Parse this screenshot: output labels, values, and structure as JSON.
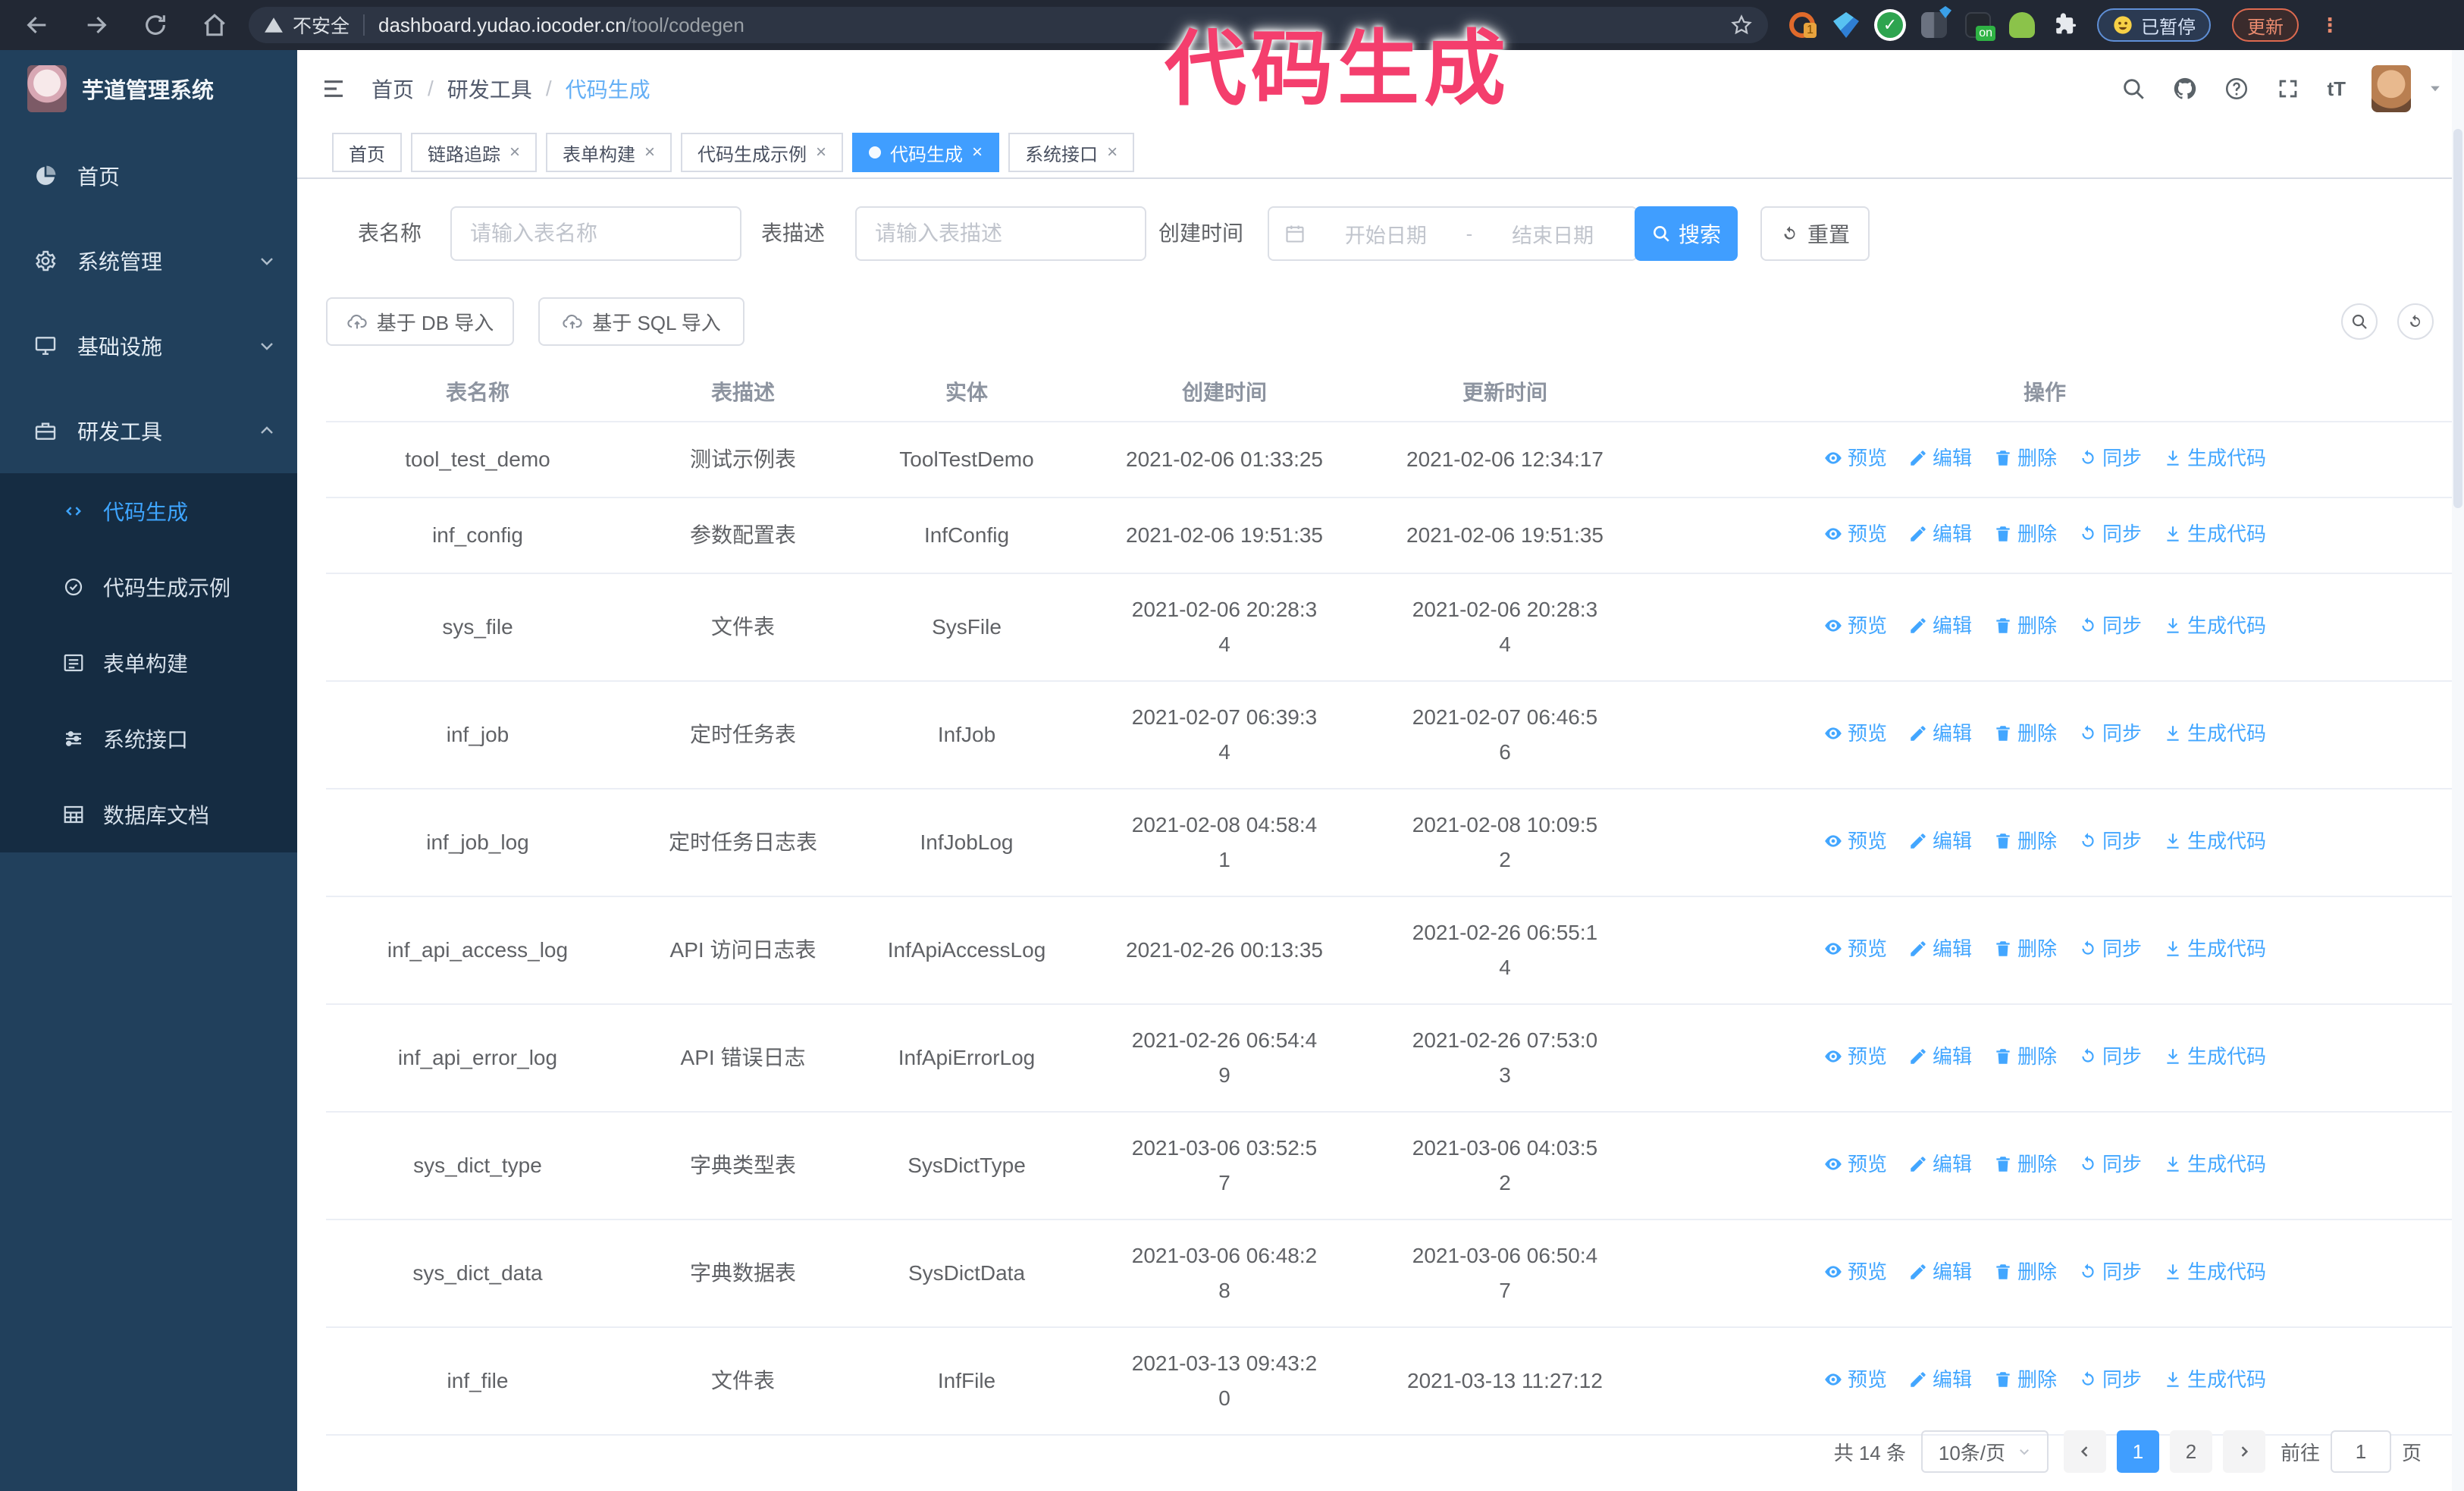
{
  "browser": {
    "security_label": "不安全",
    "url_host": "dashboard.yudao.iocoder.cn",
    "url_path": "/tool/codegen",
    "extension_badge": "1",
    "extension_on_badge": "on",
    "paused_badge": "已暂停",
    "update_button": "更新"
  },
  "annotation": {
    "text": "代码生成"
  },
  "sidebar": {
    "logo_title": "芋道管理系统",
    "items": [
      {
        "label": "首页"
      },
      {
        "label": "系统管理"
      },
      {
        "label": "基础设施"
      },
      {
        "label": "研发工具"
      }
    ],
    "submenu": [
      {
        "label": "代码生成"
      },
      {
        "label": "代码生成示例"
      },
      {
        "label": "表单构建"
      },
      {
        "label": "系统接口"
      },
      {
        "label": "数据库文档"
      }
    ]
  },
  "header": {
    "breadcrumb": [
      "首页",
      "研发工具",
      "代码生成"
    ],
    "text_size_icon": "tT"
  },
  "tabs": [
    {
      "label": "首页"
    },
    {
      "label": "链路追踪"
    },
    {
      "label": "表单构建"
    },
    {
      "label": "代码生成示例"
    },
    {
      "label": "代码生成"
    },
    {
      "label": "系统接口"
    }
  ],
  "filters": {
    "table_name_label": "表名称",
    "table_name_placeholder": "请输入表名称",
    "table_desc_label": "表描述",
    "table_desc_placeholder": "请输入表描述",
    "create_time_label": "创建时间",
    "start_placeholder": "开始日期",
    "range_separator": "-",
    "end_placeholder": "结束日期",
    "search_button": "搜索",
    "reset_button": "重置"
  },
  "toolbar": {
    "import_db": "基于 DB 导入",
    "import_sql": "基于 SQL 导入"
  },
  "table": {
    "columns": [
      "表名称",
      "表描述",
      "实体",
      "创建时间",
      "更新时间",
      "操作"
    ],
    "actions": [
      {
        "label": "预览",
        "icon": "eye-icon"
      },
      {
        "label": "编辑",
        "icon": "edit-icon"
      },
      {
        "label": "删除",
        "icon": "delete-icon"
      },
      {
        "label": "同步",
        "icon": "sync-icon"
      },
      {
        "label": "生成代码",
        "icon": "download-icon"
      }
    ],
    "rows": [
      {
        "name": "tool_test_demo",
        "desc": "测试示例表",
        "entity": "ToolTestDemo",
        "created": "2021-02-06 01:33:25",
        "updated": "2021-02-06 12:34:17"
      },
      {
        "name": "inf_config",
        "desc": "参数配置表",
        "entity": "InfConfig",
        "created": "2021-02-06 19:51:35",
        "updated": "2021-02-06 19:51:35"
      },
      {
        "name": "sys_file",
        "desc": "文件表",
        "entity": "SysFile",
        "created": "2021-02-06 20:28:3\n4",
        "updated": "2021-02-06 20:28:3\n4"
      },
      {
        "name": "inf_job",
        "desc": "定时任务表",
        "entity": "InfJob",
        "created": "2021-02-07 06:39:3\n4",
        "updated": "2021-02-07 06:46:5\n6"
      },
      {
        "name": "inf_job_log",
        "desc": "定时任务日志表",
        "entity": "InfJobLog",
        "created": "2021-02-08 04:58:4\n1",
        "updated": "2021-02-08 10:09:5\n2"
      },
      {
        "name": "inf_api_access_log",
        "desc": "API 访问日志表",
        "entity": "InfApiAccessLog",
        "created": "2021-02-26 00:13:35",
        "updated": "2021-02-26 06:55:1\n4"
      },
      {
        "name": "inf_api_error_log",
        "desc": "API 错误日志",
        "entity": "InfApiErrorLog",
        "created": "2021-02-26 06:54:4\n9",
        "updated": "2021-02-26 07:53:0\n3"
      },
      {
        "name": "sys_dict_type",
        "desc": "字典类型表",
        "entity": "SysDictType",
        "created": "2021-03-06 03:52:5\n7",
        "updated": "2021-03-06 04:03:5\n2"
      },
      {
        "name": "sys_dict_data",
        "desc": "字典数据表",
        "entity": "SysDictData",
        "created": "2021-03-06 06:48:2\n8",
        "updated": "2021-03-06 06:50:4\n7"
      },
      {
        "name": "inf_file",
        "desc": "文件表",
        "entity": "InfFile",
        "created": "2021-03-13 09:43:2\n0",
        "updated": "2021-03-13 11:27:12"
      }
    ]
  },
  "pagination": {
    "total": "共 14 条",
    "page_size": "10条/页",
    "pages": [
      "1",
      "2"
    ],
    "active_page": "1",
    "goto_label": "前往",
    "goto_value": "1",
    "goto_suffix": "页"
  },
  "colors": {
    "primary": "#409eff",
    "link": "#42a6ff",
    "annotation": "#f43e6d",
    "sidebar_bg": "#21405c",
    "submenu_bg": "#152c42",
    "browser_bar": "#222834"
  }
}
